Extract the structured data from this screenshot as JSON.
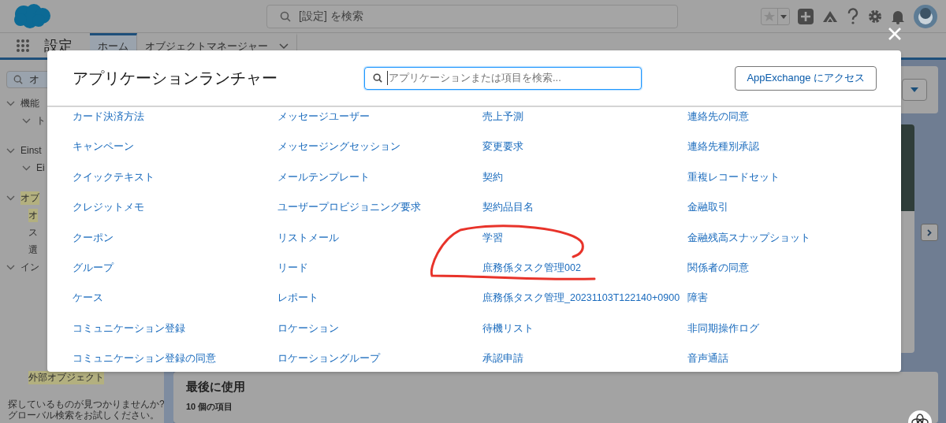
{
  "header": {
    "search_placeholder": "[設定] を検索"
  },
  "nav": {
    "app_title": "設定",
    "tabs": [
      {
        "label": "ホーム",
        "selected": true,
        "dropdown": false
      },
      {
        "label": "オブジェクトマネージャー",
        "selected": false,
        "dropdown": true
      }
    ]
  },
  "sidebar": {
    "search_value": "オ",
    "tree": [
      {
        "label": "機能",
        "expanded": true,
        "highlighted": false,
        "children": [
          {
            "label": "ト",
            "expanded": true,
            "highlighted": false
          }
        ]
      },
      {
        "label": "Einst",
        "expanded": true,
        "highlighted": false,
        "children": [
          {
            "label": "Ei",
            "expanded": true,
            "highlighted": false
          }
        ]
      },
      {
        "label": "オブ",
        "expanded": true,
        "highlighted": true,
        "children": [
          {
            "label": "オ",
            "highlighted": true
          },
          {
            "label": "ス",
            "highlighted": false
          },
          {
            "label": "選",
            "highlighted": false
          }
        ]
      },
      {
        "label": "イン",
        "expanded": true,
        "highlighted": false,
        "children": [
          {
            "label": "外部オブジェクト",
            "highlighted": true
          }
        ]
      }
    ],
    "help_lines": [
      "探しているものが見つかりませんか?",
      "グローバル検索をお試しください。"
    ]
  },
  "main": {
    "recent_title": "最後に使用",
    "recent_count": "10 個の項目"
  },
  "launcher": {
    "title": "アプリケーションランチャー",
    "search_placeholder": "アプリケーションまたは項目を検索...",
    "appexchange_button": "AppExchange にアクセス",
    "columns": [
      [
        "カード決済方法",
        "キャンペーン",
        "クイックテキスト",
        "クレジットメモ",
        "クーポン",
        "グループ",
        "ケース",
        "コミュニケーション登録",
        "コミュニケーション登録の同意"
      ],
      [
        "メッセージユーザー",
        "メッセージングセッション",
        "メールテンプレート",
        "ユーザープロビジョニング要求",
        "リストメール",
        "リード",
        "レポート",
        "ロケーション",
        "ロケーショングループ"
      ],
      [
        "売上予測",
        "変更要求",
        "契約",
        "契約品目名",
        "学習",
        "庶務係タスク管理002",
        "庶務係タスク管理_20231103T122140+0900",
        "待機リスト",
        "承認申請"
      ],
      [
        "連絡先の同意",
        "連絡先種別承認",
        "重複レコードセット",
        "金融取引",
        "金融残高スナップショット",
        "関係者の同意",
        "障害",
        "非同期操作ログ",
        "音声通話"
      ]
    ]
  }
}
